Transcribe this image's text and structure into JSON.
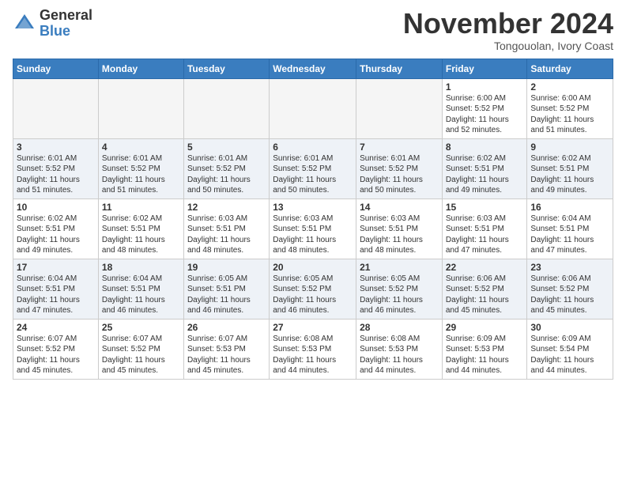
{
  "header": {
    "logo_general": "General",
    "logo_blue": "Blue",
    "month": "November 2024",
    "location": "Tongouolan, Ivory Coast"
  },
  "weekdays": [
    "Sunday",
    "Monday",
    "Tuesday",
    "Wednesday",
    "Thursday",
    "Friday",
    "Saturday"
  ],
  "rows": [
    [
      {
        "day": "",
        "info": ""
      },
      {
        "day": "",
        "info": ""
      },
      {
        "day": "",
        "info": ""
      },
      {
        "day": "",
        "info": ""
      },
      {
        "day": "",
        "info": ""
      },
      {
        "day": "1",
        "info": "Sunrise: 6:00 AM\nSunset: 5:52 PM\nDaylight: 11 hours\nand 52 minutes."
      },
      {
        "day": "2",
        "info": "Sunrise: 6:00 AM\nSunset: 5:52 PM\nDaylight: 11 hours\nand 51 minutes."
      }
    ],
    [
      {
        "day": "3",
        "info": "Sunrise: 6:01 AM\nSunset: 5:52 PM\nDaylight: 11 hours\nand 51 minutes."
      },
      {
        "day": "4",
        "info": "Sunrise: 6:01 AM\nSunset: 5:52 PM\nDaylight: 11 hours\nand 51 minutes."
      },
      {
        "day": "5",
        "info": "Sunrise: 6:01 AM\nSunset: 5:52 PM\nDaylight: 11 hours\nand 50 minutes."
      },
      {
        "day": "6",
        "info": "Sunrise: 6:01 AM\nSunset: 5:52 PM\nDaylight: 11 hours\nand 50 minutes."
      },
      {
        "day": "7",
        "info": "Sunrise: 6:01 AM\nSunset: 5:52 PM\nDaylight: 11 hours\nand 50 minutes."
      },
      {
        "day": "8",
        "info": "Sunrise: 6:02 AM\nSunset: 5:51 PM\nDaylight: 11 hours\nand 49 minutes."
      },
      {
        "day": "9",
        "info": "Sunrise: 6:02 AM\nSunset: 5:51 PM\nDaylight: 11 hours\nand 49 minutes."
      }
    ],
    [
      {
        "day": "10",
        "info": "Sunrise: 6:02 AM\nSunset: 5:51 PM\nDaylight: 11 hours\nand 49 minutes."
      },
      {
        "day": "11",
        "info": "Sunrise: 6:02 AM\nSunset: 5:51 PM\nDaylight: 11 hours\nand 48 minutes."
      },
      {
        "day": "12",
        "info": "Sunrise: 6:03 AM\nSunset: 5:51 PM\nDaylight: 11 hours\nand 48 minutes."
      },
      {
        "day": "13",
        "info": "Sunrise: 6:03 AM\nSunset: 5:51 PM\nDaylight: 11 hours\nand 48 minutes."
      },
      {
        "day": "14",
        "info": "Sunrise: 6:03 AM\nSunset: 5:51 PM\nDaylight: 11 hours\nand 48 minutes."
      },
      {
        "day": "15",
        "info": "Sunrise: 6:03 AM\nSunset: 5:51 PM\nDaylight: 11 hours\nand 47 minutes."
      },
      {
        "day": "16",
        "info": "Sunrise: 6:04 AM\nSunset: 5:51 PM\nDaylight: 11 hours\nand 47 minutes."
      }
    ],
    [
      {
        "day": "17",
        "info": "Sunrise: 6:04 AM\nSunset: 5:51 PM\nDaylight: 11 hours\nand 47 minutes."
      },
      {
        "day": "18",
        "info": "Sunrise: 6:04 AM\nSunset: 5:51 PM\nDaylight: 11 hours\nand 46 minutes."
      },
      {
        "day": "19",
        "info": "Sunrise: 6:05 AM\nSunset: 5:51 PM\nDaylight: 11 hours\nand 46 minutes."
      },
      {
        "day": "20",
        "info": "Sunrise: 6:05 AM\nSunset: 5:52 PM\nDaylight: 11 hours\nand 46 minutes."
      },
      {
        "day": "21",
        "info": "Sunrise: 6:05 AM\nSunset: 5:52 PM\nDaylight: 11 hours\nand 46 minutes."
      },
      {
        "day": "22",
        "info": "Sunrise: 6:06 AM\nSunset: 5:52 PM\nDaylight: 11 hours\nand 45 minutes."
      },
      {
        "day": "23",
        "info": "Sunrise: 6:06 AM\nSunset: 5:52 PM\nDaylight: 11 hours\nand 45 minutes."
      }
    ],
    [
      {
        "day": "24",
        "info": "Sunrise: 6:07 AM\nSunset: 5:52 PM\nDaylight: 11 hours\nand 45 minutes."
      },
      {
        "day": "25",
        "info": "Sunrise: 6:07 AM\nSunset: 5:52 PM\nDaylight: 11 hours\nand 45 minutes."
      },
      {
        "day": "26",
        "info": "Sunrise: 6:07 AM\nSunset: 5:53 PM\nDaylight: 11 hours\nand 45 minutes."
      },
      {
        "day": "27",
        "info": "Sunrise: 6:08 AM\nSunset: 5:53 PM\nDaylight: 11 hours\nand 44 minutes."
      },
      {
        "day": "28",
        "info": "Sunrise: 6:08 AM\nSunset: 5:53 PM\nDaylight: 11 hours\nand 44 minutes."
      },
      {
        "day": "29",
        "info": "Sunrise: 6:09 AM\nSunset: 5:53 PM\nDaylight: 11 hours\nand 44 minutes."
      },
      {
        "day": "30",
        "info": "Sunrise: 6:09 AM\nSunset: 5:54 PM\nDaylight: 11 hours\nand 44 minutes."
      }
    ]
  ]
}
